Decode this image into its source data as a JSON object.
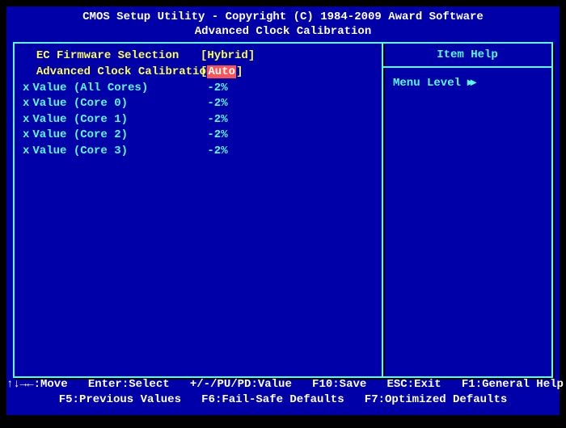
{
  "header": {
    "line1": "CMOS Setup Utility - Copyright (C) 1984-2009 Award Software",
    "line2": "Advanced Clock Calibration"
  },
  "settings": [
    {
      "label": "EC Firmware Selection",
      "value": "Hybrid",
      "bracketed": true,
      "enabled": true,
      "selected": false,
      "prefix": ""
    },
    {
      "label": "Advanced Clock Calibration",
      "value": "Auto",
      "bracketed": true,
      "enabled": true,
      "selected": true,
      "prefix": ""
    },
    {
      "label": "Value (All Cores)",
      "value": "-2%",
      "bracketed": false,
      "enabled": false,
      "selected": false,
      "prefix": "x"
    },
    {
      "label": "Value (Core 0)",
      "value": "-2%",
      "bracketed": false,
      "enabled": false,
      "selected": false,
      "prefix": "x"
    },
    {
      "label": "Value (Core 1)",
      "value": "-2%",
      "bracketed": false,
      "enabled": false,
      "selected": false,
      "prefix": "x"
    },
    {
      "label": "Value (Core 2)",
      "value": "-2%",
      "bracketed": false,
      "enabled": false,
      "selected": false,
      "prefix": "x"
    },
    {
      "label": "Value (Core 3)",
      "value": "-2%",
      "bracketed": false,
      "enabled": false,
      "selected": false,
      "prefix": "x"
    }
  ],
  "help": {
    "title": "Item Help",
    "menu_level": "Menu Level"
  },
  "footer": {
    "row1": "↑↓→←:Move   Enter:Select   +/-/PU/PD:Value   F10:Save   ESC:Exit   F1:General Help",
    "row2": "F5:Previous Values   F6:Fail-Safe Defaults   F7:Optimized Defaults"
  }
}
